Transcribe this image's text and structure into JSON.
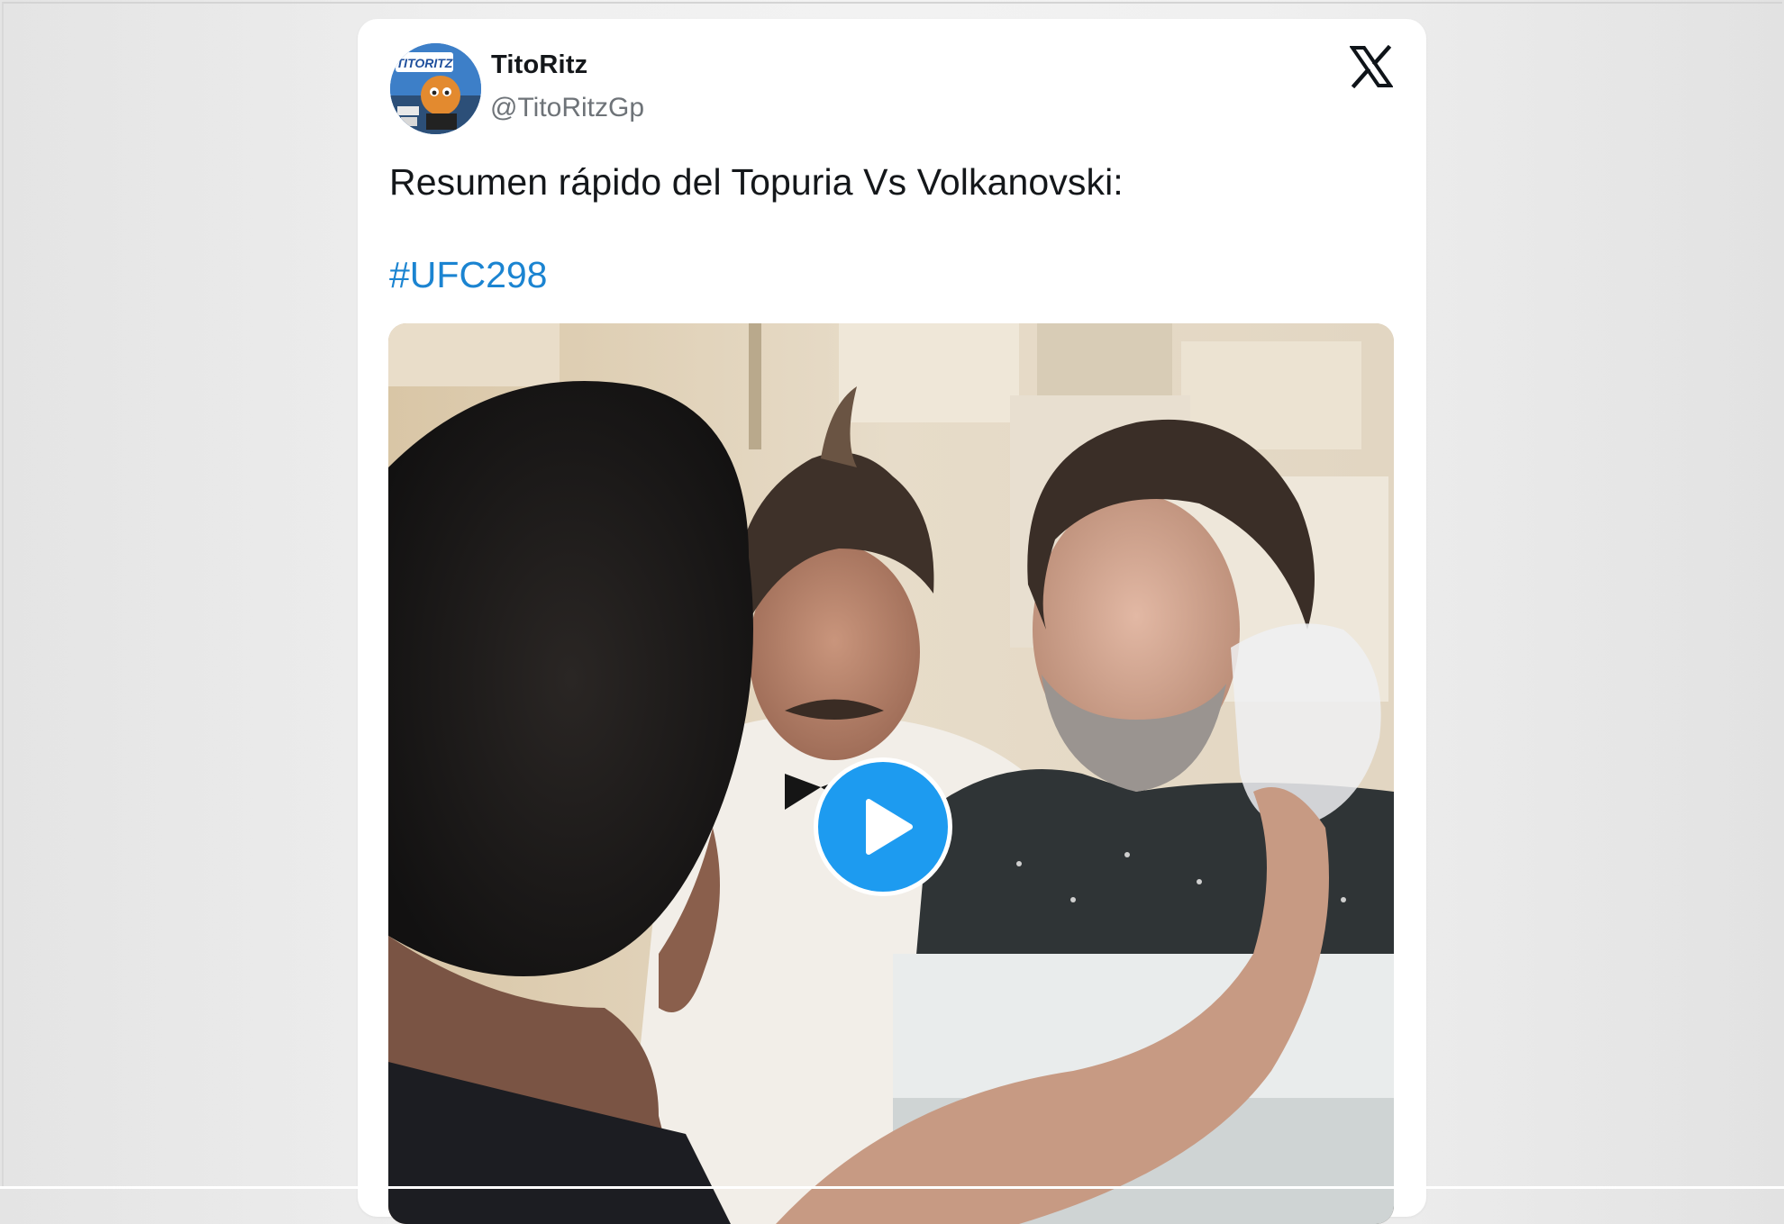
{
  "tweet": {
    "author_name": "TitoRitz",
    "author_handle": "@TitoRitzGp",
    "avatar_text": "TITORITZ",
    "text": "Resumen rápido del Topuria Vs Volkanovski:",
    "hashtag": "#UFC298",
    "platform_icon": "x-logo-icon",
    "media": {
      "type": "video",
      "play_icon": "play-icon"
    }
  },
  "colors": {
    "hashtag": "#1b84d1",
    "play_button": "#1d9bf0",
    "name_text": "#14171a",
    "handle_text": "#6e7378"
  }
}
